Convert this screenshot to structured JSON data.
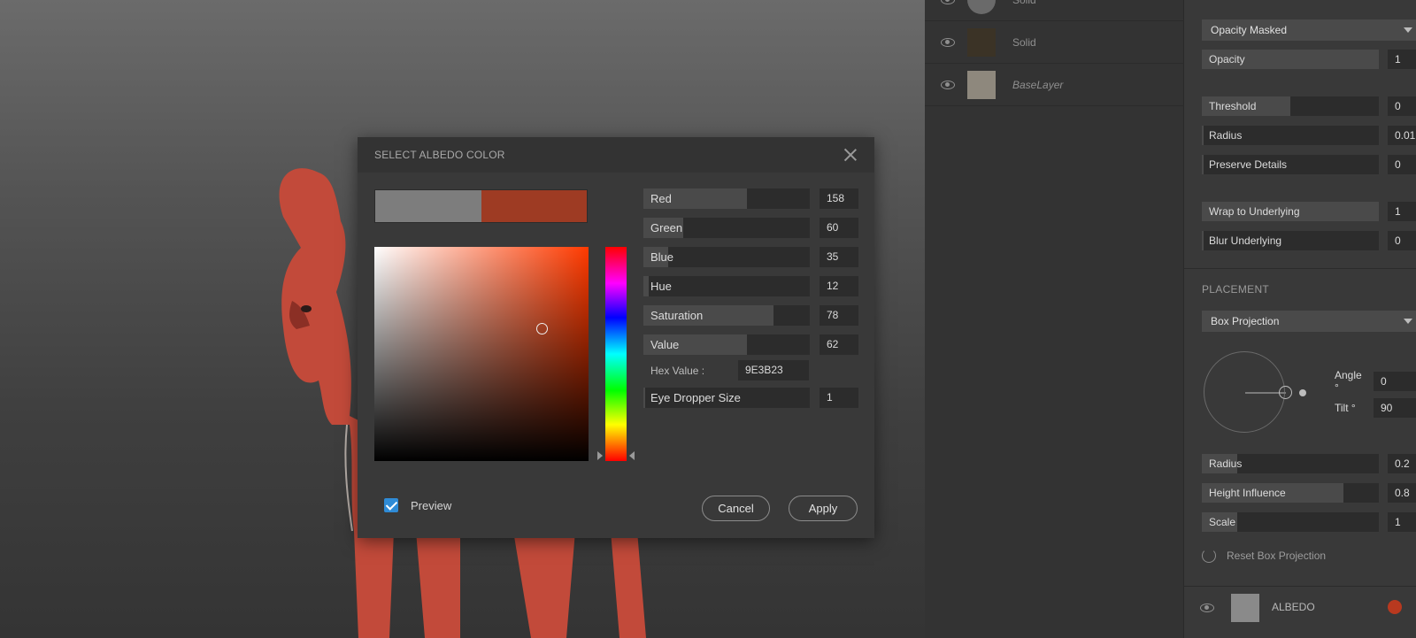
{
  "dialog": {
    "title": "SELECT ALBEDO COLOR",
    "old_color": "#7d7d7d",
    "new_color": "#9E3B23",
    "hue_color": "#ff3a00",
    "sliders": [
      {
        "label": "Red",
        "value": "158",
        "fraction": 0.62
      },
      {
        "label": "Green",
        "value": "60",
        "fraction": 0.24
      },
      {
        "label": "Blue",
        "value": "35",
        "fraction": 0.15
      },
      {
        "label": "Hue",
        "value": "12",
        "fraction": 0.03
      },
      {
        "label": "Saturation",
        "value": "78",
        "fraction": 0.78
      },
      {
        "label": "Value",
        "value": "62",
        "fraction": 0.62
      }
    ],
    "hex_label": "Hex Value :",
    "hex_value": "9E3B23",
    "eye_dropper": {
      "label": "Eye Dropper Size",
      "value": "1",
      "fraction": 0.01
    },
    "preview_label": "Preview",
    "preview_checked": true,
    "cancel_label": "Cancel",
    "apply_label": "Apply"
  },
  "layers": [
    {
      "name": "Solid",
      "thumb": "#6a6a6a",
      "round": true
    },
    {
      "name": "Solid",
      "thumb": "#3b3326"
    },
    {
      "name": "BaseLayer",
      "thumb": "#8e887d",
      "italic": true
    }
  ],
  "props": {
    "blend_mode": "Opacity Masked",
    "opacity": {
      "label": "Opacity",
      "value": "1",
      "fraction": 1.0
    },
    "threshold": {
      "label": "Threshold",
      "value": "0",
      "fraction": 0.5
    },
    "radius": {
      "label": "Radius",
      "value": "0.01",
      "fraction": 0.01
    },
    "preserve": {
      "label": "Preserve Details",
      "value": "0",
      "fraction": 0.01
    },
    "wrap": {
      "label": "Wrap to Underlying",
      "value": "1",
      "fraction": 1.0
    },
    "blur": {
      "label": "Blur Underlying",
      "value": "0",
      "fraction": 0.01
    },
    "placement_title": "PLACEMENT",
    "projection": "Box Projection",
    "angle_label": "Angle °",
    "angle_value": "0",
    "tilt_label": "Tilt °",
    "tilt_value": "90",
    "radius2": {
      "label": "Radius",
      "value": "0.2",
      "fraction": 0.2
    },
    "height_influence": {
      "label": "Height Influence",
      "value": "0.8",
      "fraction": 0.8
    },
    "scale": {
      "label": "Scale",
      "value": "1",
      "fraction": 0.2
    },
    "reset_label": "Reset Box Projection",
    "albedo_label": "ALBEDO",
    "albedo_color": "#b8391f"
  }
}
